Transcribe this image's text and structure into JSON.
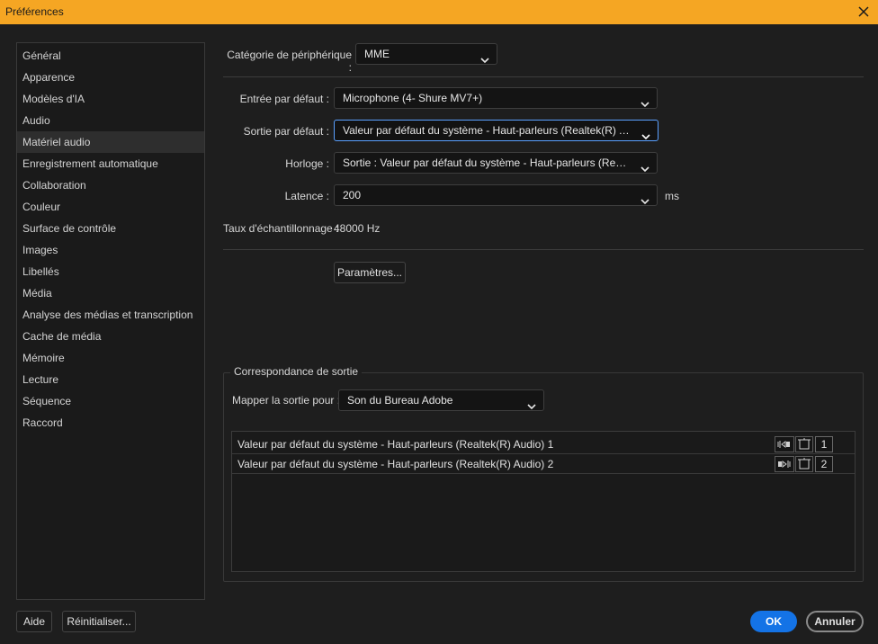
{
  "window": {
    "title": "Préférences"
  },
  "sidebar": {
    "items": [
      {
        "label": "Général"
      },
      {
        "label": "Apparence"
      },
      {
        "label": "Modèles d'IA"
      },
      {
        "label": "Audio"
      },
      {
        "label": "Matériel audio",
        "selected": true
      },
      {
        "label": "Enregistrement automatique"
      },
      {
        "label": "Collaboration"
      },
      {
        "label": "Couleur"
      },
      {
        "label": "Surface de contrôle"
      },
      {
        "label": "Images"
      },
      {
        "label": "Libellés"
      },
      {
        "label": "Média"
      },
      {
        "label": "Analyse des médias et transcription"
      },
      {
        "label": "Cache de média"
      },
      {
        "label": "Mémoire"
      },
      {
        "label": "Lecture"
      },
      {
        "label": "Séquence"
      },
      {
        "label": "Raccord"
      }
    ]
  },
  "device": {
    "category_label": "Catégorie de périphérique :",
    "category_value": "MME",
    "input_label": "Entrée par défaut :",
    "input_value": "Microphone (4- Shure MV7+)",
    "output_label": "Sortie par défaut :",
    "output_value": "Valeur par défaut du système - Haut-parleurs (Realtek(R) Audio)",
    "clock_label": "Horloge :",
    "clock_value": "Sortie : Valeur par défaut du système - Haut-parleurs (Realtek(R) Audio)",
    "latency_label": "Latence :",
    "latency_value": "200",
    "latency_unit": "ms",
    "sample_rate_label": "Taux d'échantillonnage :",
    "sample_rate_value": "48000 Hz",
    "settings_button": "Paramètres..."
  },
  "output_mapping": {
    "group_title": "Correspondance de sortie",
    "map_label": "Mapper la sortie pour :",
    "map_value": "Son du Bureau Adobe",
    "rows": [
      {
        "label": "Valeur par défaut du système - Haut-parleurs (Realtek(R) Audio) 1",
        "channel": "1"
      },
      {
        "label": "Valeur par défaut du système - Haut-parleurs (Realtek(R) Audio) 2",
        "channel": "2"
      }
    ]
  },
  "footer": {
    "help": "Aide",
    "reset": "Réinitialiser...",
    "ok": "OK",
    "cancel": "Annuler"
  },
  "colors": {
    "titlebar": "#f5a623",
    "accent": "#1473e6",
    "focus": "#5aa0ff",
    "background": "#1e1e1e"
  }
}
